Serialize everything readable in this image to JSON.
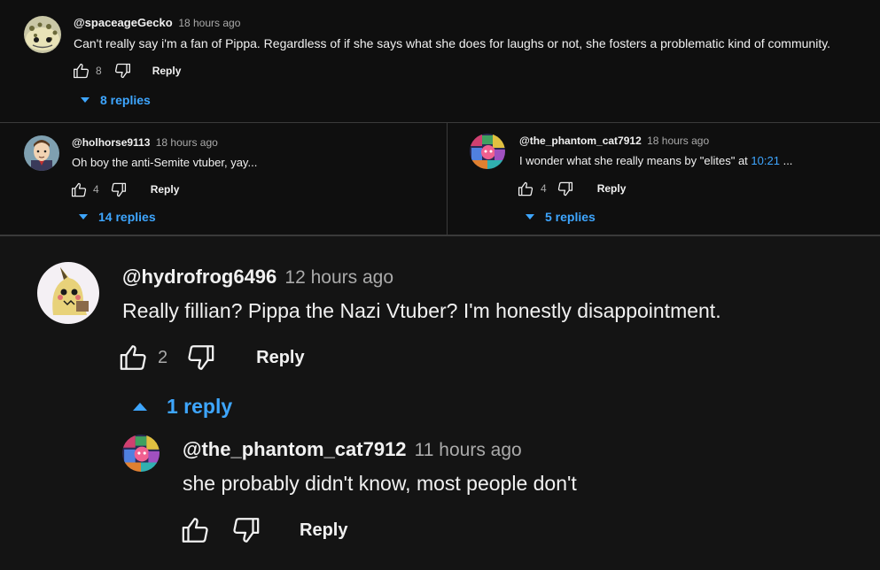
{
  "colors": {
    "background": "#0f0f0f",
    "text": "#f1f1f1",
    "muted": "#aaaaaa",
    "link": "#3ea6ff",
    "divider": "#3a3a3a"
  },
  "comments": {
    "c1": {
      "avatar_icon": "gecko-avatar-icon",
      "handle": "@spaceageGecko",
      "time": "18 hours ago",
      "text": "Can't really say i'm a fan of Pippa. Regardless of if she says what she does for laughs or not, she fosters a problematic kind of community.",
      "likes": "8",
      "reply_label": "Reply",
      "replies_label": "8 replies"
    },
    "c2": {
      "avatar_icon": "cartoon-man-avatar-icon",
      "handle": "@holhorse9113",
      "time": "18 hours ago",
      "text": "Oh boy the anti-Semite vtuber, yay...",
      "likes": "4",
      "reply_label": "Reply",
      "replies_label": "14 replies"
    },
    "c3": {
      "avatar_icon": "colorful-collage-avatar-icon",
      "handle": "@the_phantom_cat7912",
      "time": "18 hours ago",
      "text_before": "I wonder what she really means by \"elites\" at ",
      "timestamp_link": "10:21",
      "text_after": " ...",
      "likes": "4",
      "reply_label": "Reply",
      "replies_label": "5 replies"
    },
    "c4": {
      "avatar_icon": "mimikyu-avatar-icon",
      "handle": "@hydrofrog6496",
      "time": "12 hours ago",
      "text": "Really fillian? Pippa the Nazi Vtuber? I'm honestly disappointment.",
      "likes": "2",
      "reply_label": "Reply",
      "replies_label": "1 reply"
    },
    "c5": {
      "avatar_icon": "colorful-collage-avatar-icon",
      "handle": "@the_phantom_cat7912",
      "time": "11 hours ago",
      "text": "she probably didn't know, most people don't",
      "reply_label": "Reply"
    }
  }
}
